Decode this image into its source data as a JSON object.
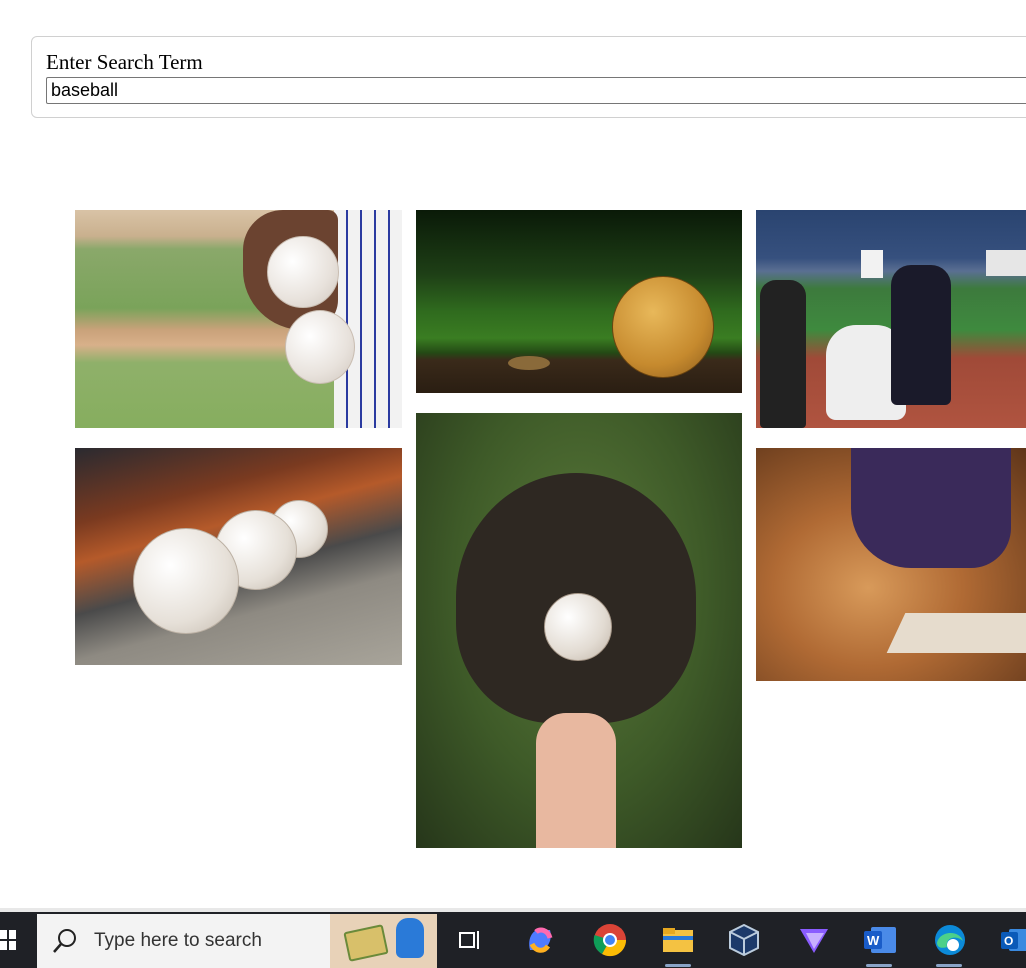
{
  "search": {
    "label": "Enter Search Term",
    "value": "baseball"
  },
  "gallery": {
    "images": [
      {
        "subject": "hand holding baseballs"
      },
      {
        "subject": "baseball on wooden rail"
      },
      {
        "subject": "batter at home plate"
      },
      {
        "subject": "baseballs on dugout ledge"
      },
      {
        "subject": "baseball in glove"
      },
      {
        "subject": "player sliding into base"
      }
    ]
  },
  "taskbar": {
    "search_placeholder": "Type here to search",
    "apps": [
      "task-view-icon",
      "copilot-icon",
      "chrome-icon",
      "file-explorer-icon",
      "virtualbox-icon",
      "proton-vpn-icon",
      "word-icon",
      "edge-icon",
      "outlook-icon"
    ]
  }
}
